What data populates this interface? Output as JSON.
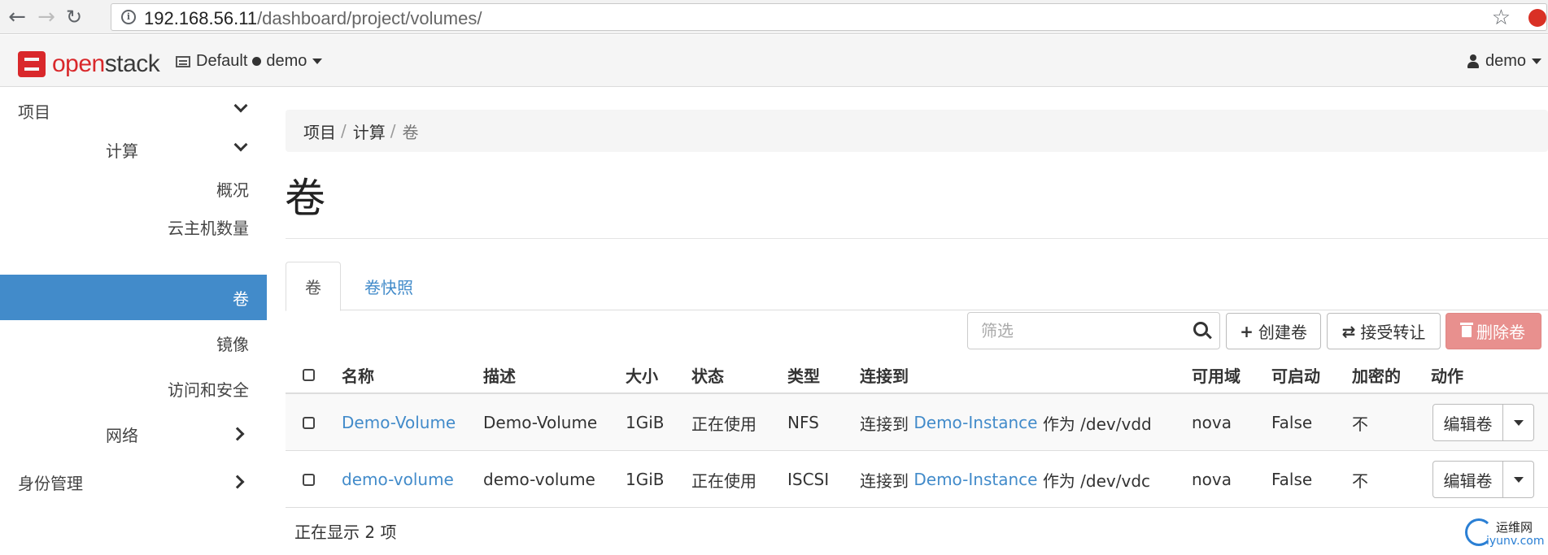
{
  "browser": {
    "url_host": "192.168.56.11",
    "url_path": "/dashboard/project/volumes/"
  },
  "header": {
    "logo_open": "open",
    "logo_stack": "stack",
    "domain": "Default",
    "project": "demo",
    "user": "demo"
  },
  "sidebar": {
    "items": [
      {
        "label": "项目",
        "level": 0,
        "expanded": true
      },
      {
        "label": "计算",
        "level": 1,
        "expanded": true
      },
      {
        "label": "概况",
        "level": 2
      },
      {
        "label": "云主机数量",
        "level": 2
      },
      {
        "label": "卷",
        "level": 2,
        "active": true
      },
      {
        "label": "镜像",
        "level": 2
      },
      {
        "label": "访问和安全",
        "level": 2
      },
      {
        "label": "网络",
        "level": 1,
        "expanded": false
      },
      {
        "label": "身份管理",
        "level": 0,
        "expanded": false
      }
    ]
  },
  "breadcrumb": [
    "项目",
    "计算",
    "卷"
  ],
  "page_title": "卷",
  "tabs": [
    {
      "label": "卷",
      "active": true
    },
    {
      "label": "卷快照",
      "active": false
    }
  ],
  "toolbar": {
    "filter_placeholder": "筛选",
    "create_label": "创建卷",
    "accept_label": "接受转让",
    "delete_label": "删除卷"
  },
  "table": {
    "columns": [
      "名称",
      "描述",
      "大小",
      "状态",
      "类型",
      "连接到",
      "可用域",
      "可启动",
      "加密的",
      "动作"
    ],
    "rows": [
      {
        "name": "Demo-Volume",
        "description": "Demo-Volume",
        "size": "1GiB",
        "status": "正在使用",
        "type": "NFS",
        "attach_prefix": "连接到",
        "attach_instance": "Demo-Instance",
        "attach_suffix": "作为 /dev/vdd",
        "az": "nova",
        "bootable": "False",
        "encrypted": "不",
        "action": "编辑卷"
      },
      {
        "name": "demo-volume",
        "description": "demo-volume",
        "size": "1GiB",
        "status": "正在使用",
        "type": "ISCSI",
        "attach_prefix": "连接到",
        "attach_instance": "Demo-Instance",
        "attach_suffix": "作为 /dev/vdc",
        "az": "nova",
        "bootable": "False",
        "encrypted": "不",
        "action": "编辑卷"
      }
    ],
    "footer": "正在显示 2 项"
  },
  "watermark": {
    "line1": "运维网",
    "line2": "iyunv.com"
  },
  "colors": {
    "accent": "#428bca",
    "brand_red": "#d9282b",
    "danger_button": "#e8908e"
  }
}
